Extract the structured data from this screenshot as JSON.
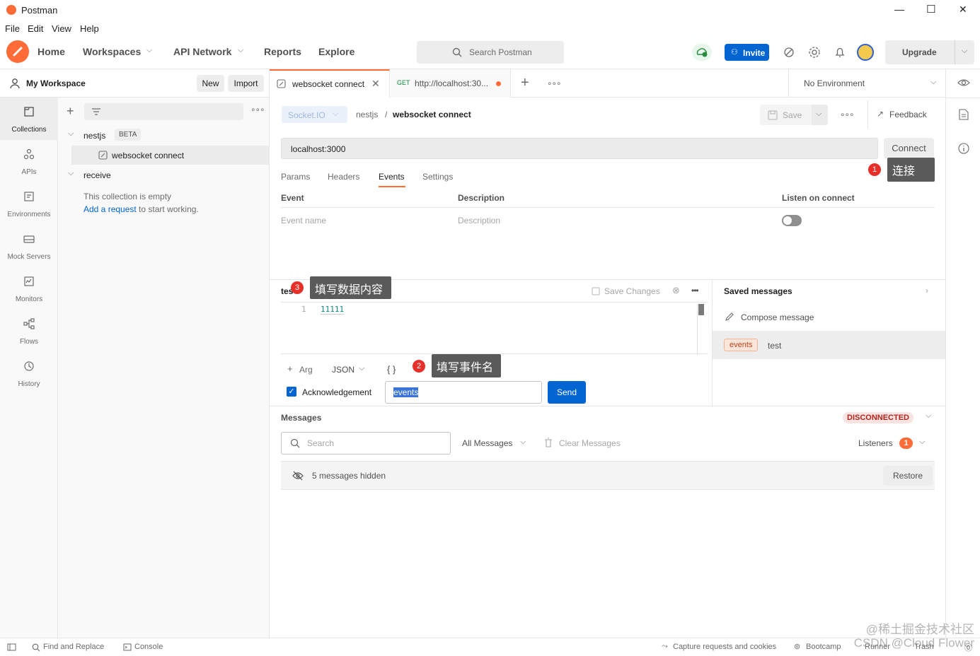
{
  "window": {
    "title": "Postman",
    "minimize": "—",
    "maximize": "☐",
    "close": "✕"
  },
  "menu": [
    "File",
    "Edit",
    "View",
    "Help"
  ],
  "header": {
    "home": "Home",
    "workspaces": "Workspaces",
    "api_network": "API Network",
    "reports": "Reports",
    "explore": "Explore",
    "search_placeholder": "Search Postman",
    "invite": "Invite",
    "upgrade": "Upgrade"
  },
  "workspace": {
    "name": "My Workspace",
    "new_btn": "New",
    "import_btn": "Import"
  },
  "sidebar": [
    {
      "label": "Collections",
      "icon": "collections-icon"
    },
    {
      "label": "APIs",
      "icon": "apis-icon"
    },
    {
      "label": "Environments",
      "icon": "environments-icon"
    },
    {
      "label": "Mock Servers",
      "icon": "mock-servers-icon"
    },
    {
      "label": "Monitors",
      "icon": "monitors-icon"
    },
    {
      "label": "Flows",
      "icon": "flows-icon"
    },
    {
      "label": "History",
      "icon": "history-icon"
    }
  ],
  "tree": {
    "collection1": "nestjs",
    "collection1_badge": "BETA",
    "request1": "websocket connect",
    "collection2": "receive",
    "empty_text": "This collection is empty",
    "add_request_link": "Add a request",
    "add_request_rest": " to start working."
  },
  "tabs": {
    "tab1": "websocket connect",
    "tab2_method": "GET",
    "tab2": "http://localhost:30...",
    "environment": "No Environment"
  },
  "request": {
    "type": "Socket.IO",
    "breadcrumb_parent": "nestjs",
    "breadcrumb_sep": "/",
    "name": "websocket connect",
    "save": "Save",
    "feedback": "Feedback",
    "url": "localhost:3000",
    "connect": "Connect",
    "subtabs": [
      "Params",
      "Headers",
      "Events",
      "Settings"
    ],
    "events_table": {
      "col_event": "Event",
      "col_desc": "Description",
      "col_listen": "Listen on connect",
      "event_placeholder": "Event name",
      "desc_placeholder": "Description"
    }
  },
  "composer": {
    "name": "tes",
    "save_changes": "Save Changes",
    "line_no": "1",
    "line_text": "11111",
    "arg": "Arg",
    "format": "JSON",
    "braces": "{ }",
    "ack": "Acknowledgement",
    "event_value": "events",
    "send": "Send"
  },
  "saved": {
    "title": "Saved messages",
    "compose": "Compose message",
    "item_tag": "events",
    "item_name": "test"
  },
  "messages": {
    "title": "Messages",
    "status": "DISCONNECTED",
    "search_placeholder": "Search",
    "filter": "All Messages",
    "clear": "Clear Messages",
    "listeners": "Listeners",
    "listeners_count": "1",
    "hidden": "5 messages hidden",
    "restore": "Restore"
  },
  "annotations": {
    "a1_num": "1",
    "a1_text": "连接",
    "a2_num": "2",
    "a2_text": "填写事件名",
    "a3_num": "3",
    "a3_text": "填写数据内容"
  },
  "footer": {
    "find_replace": "Find and Replace",
    "console": "Console",
    "capture": "Capture requests and cookies",
    "bootcamp": "Bootcamp",
    "runner": "Runner",
    "trash": "Trash"
  },
  "watermark": "@稀土掘金技术社区\nCSDN @Cloud Flower",
  "colors": {
    "accent": "#ff6c37",
    "primary": "#0265d2",
    "danger": "#e8302a"
  }
}
